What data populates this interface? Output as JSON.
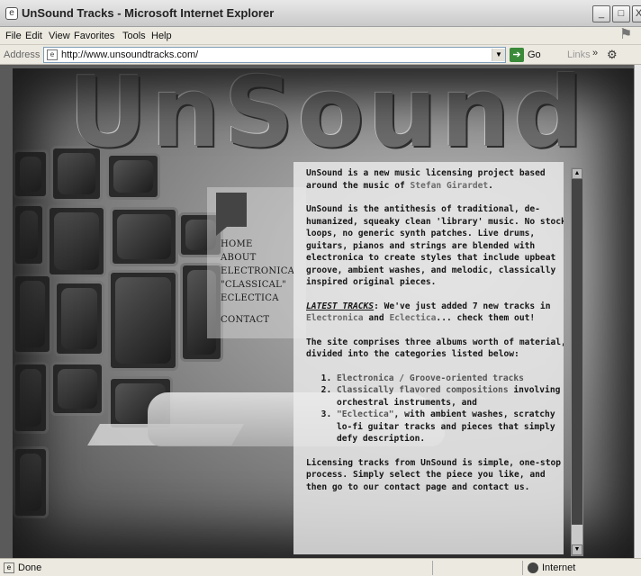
{
  "window": {
    "title": "UnSound Tracks - Microsoft Internet Explorer",
    "min_glyph": "_",
    "max_glyph": "□",
    "close_glyph": "X"
  },
  "menu": [
    "File",
    "Edit",
    "View",
    "Favorites",
    "Tools",
    "Help"
  ],
  "address": {
    "label": "Address",
    "url": "http://www.unsoundtracks.com/",
    "go_label": "Go",
    "links_label": "Links",
    "links_chevron": "»"
  },
  "site": {
    "logo": "UnSound",
    "nav": [
      "HOME",
      "ABOUT",
      "ELECTRONICA",
      "\"CLASSICAL\"",
      "ECLECTICA",
      "CONTACT"
    ],
    "content": {
      "p1_pre": "UnSound is a new music licensing project based around the music of ",
      "p1_link": "Stefan Girardet",
      "p1_post": ".",
      "p2": "UnSound is the antithesis of traditional, de-humanized, squeaky clean 'library' music. No stock loops, no generic synth patches. Live drums, guitars, pianos and strings are blended with electronica to create styles that include upbeat groove, ambient washes, and melodic, classically inspired original pieces.",
      "latest_label": "LATEST TRACKS",
      "latest_pre": ": We've just added 7 new tracks in ",
      "latest_link1": "Electronica",
      "latest_mid": " and ",
      "latest_link2": "Eclectica",
      "latest_post": "... check them out!",
      "p4": "The site comprises three albums worth of material, divided into the categories listed below:",
      "list": [
        {
          "title": "Electronica / Groove-oriented tracks",
          "desc": ""
        },
        {
          "title": "Classically flavored compositions",
          "desc": " involving orchestral instruments, and"
        },
        {
          "title": "\"Eclectica\"",
          "desc": ", with ambient washes, scratchy lo-fi guitar tracks and pieces that simply defy description."
        }
      ],
      "p5": "Licensing tracks from UnSound is simple, one-stop process. Simply select the piece you like, and then go to our contact page and contact us."
    }
  },
  "status": {
    "text": "Done",
    "zone": "Internet"
  }
}
